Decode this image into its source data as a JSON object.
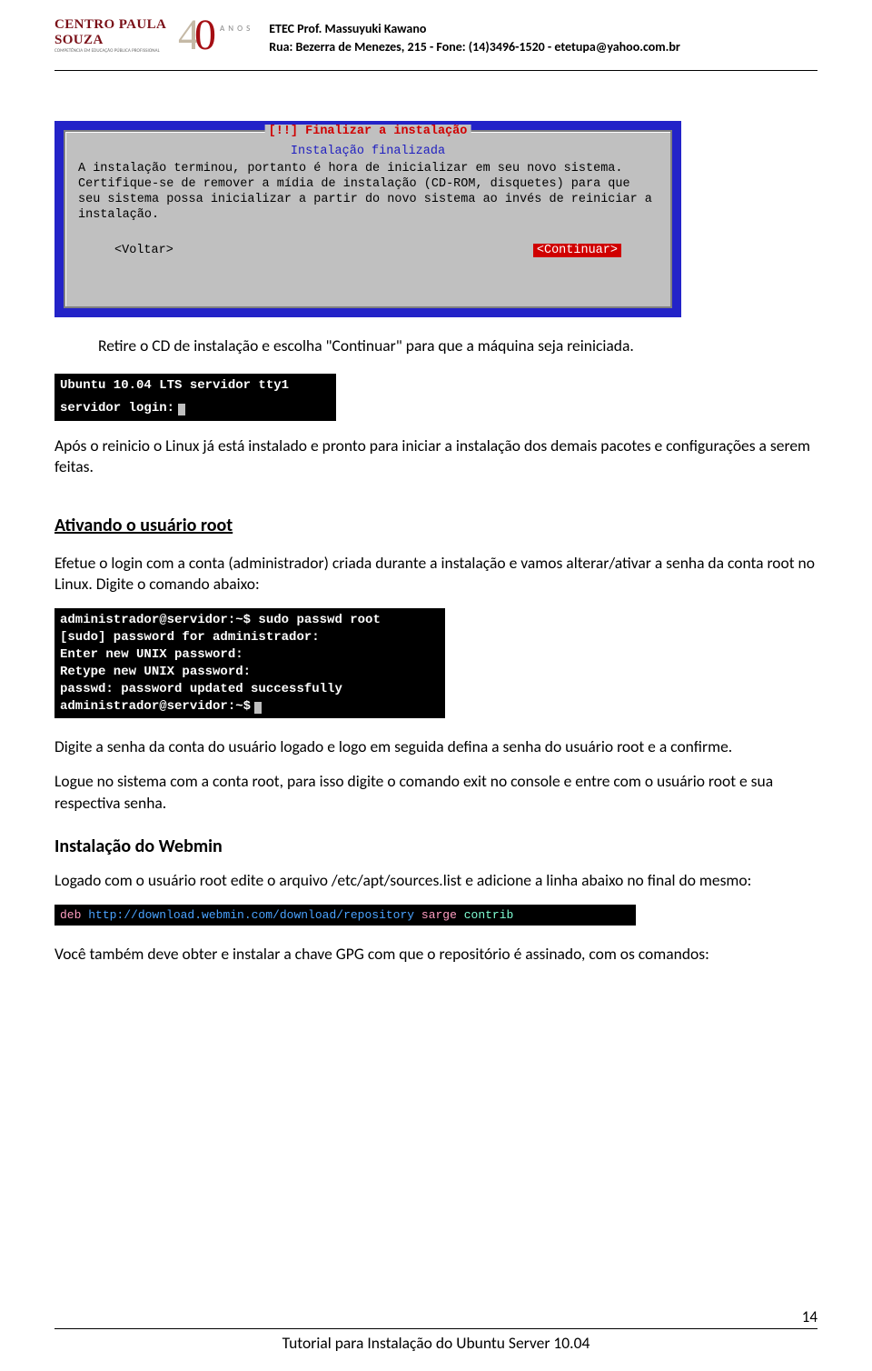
{
  "header": {
    "logo_main": "CENTRO PAULA SOUZA",
    "logo_sub": "COMPETÊNCIA EM EDUCAÇÃO PÚBLICA PROFISSIONAL",
    "anniv_anos": "A N O S",
    "line1": "ETEC Prof. Massuyuki Kawano",
    "line2": "Rua: Bezerra de Menezes, 215 - Fone: (14)3496-1520 - etetupa@yahoo.com.br"
  },
  "installer": {
    "title": "[!!] Finalizar a instalação",
    "subtitle": "Instalação finalizada",
    "body": "A instalação terminou, portanto é hora de inicializar em seu novo sistema. Certifique-se de remover a mídia de instalação (CD-ROM, disquetes) para que seu sistema possa inicializar a partir do novo sistema ao invés de reiniciar a instalação.",
    "back": "<Voltar>",
    "cont": "<Continuar>"
  },
  "body": {
    "p1": "Retire o CD de instalação e escolha \"Continuar\" para que a máquina seja reiniciada.",
    "login_line1": "Ubuntu 10.04 LTS servidor tty1",
    "login_line2": "servidor login:",
    "p2": "Após o reinicio o Linux já está instalado e pronto para iniciar a instalação dos demais pacotes e configurações a serem feitas.",
    "h1": "Ativando o usuário root",
    "p3": "Efetue o login com a conta (administrador) criada durante a instalação e vamos alterar/ativar a senha da conta root no Linux. Digite o comando abaixo:",
    "passwd_lines": [
      "administrador@servidor:~$ sudo passwd root",
      "[sudo] password for administrador:",
      "Enter new UNIX password:",
      "Retype new UNIX password:",
      "passwd: password updated successfully",
      "administrador@servidor:~$"
    ],
    "p4": "Digite a senha da conta do usuário logado e logo em seguida defina a senha do usuário root e a confirme.",
    "p5": "Logue no sistema com a conta root, para isso digite o comando exit no console e entre com o usuário root e sua respectiva senha.",
    "h2": "Instalação do Webmin",
    "p6": "Logado com o usuário root edite o arquivo /etc/apt/sources.list e adicione a linha abaixo no final do mesmo:",
    "deb_kw": "deb",
    "deb_url": "http://download.webmin.com/download/repository",
    "deb_dist": "sarge",
    "deb_comp": "contrib",
    "p7": "Você também deve obter e instalar a chave GPG com que o repositório é assinado, com os comandos:"
  },
  "footer": {
    "page": "14",
    "title": "Tutorial para Instalação do Ubuntu Server 10.04"
  }
}
